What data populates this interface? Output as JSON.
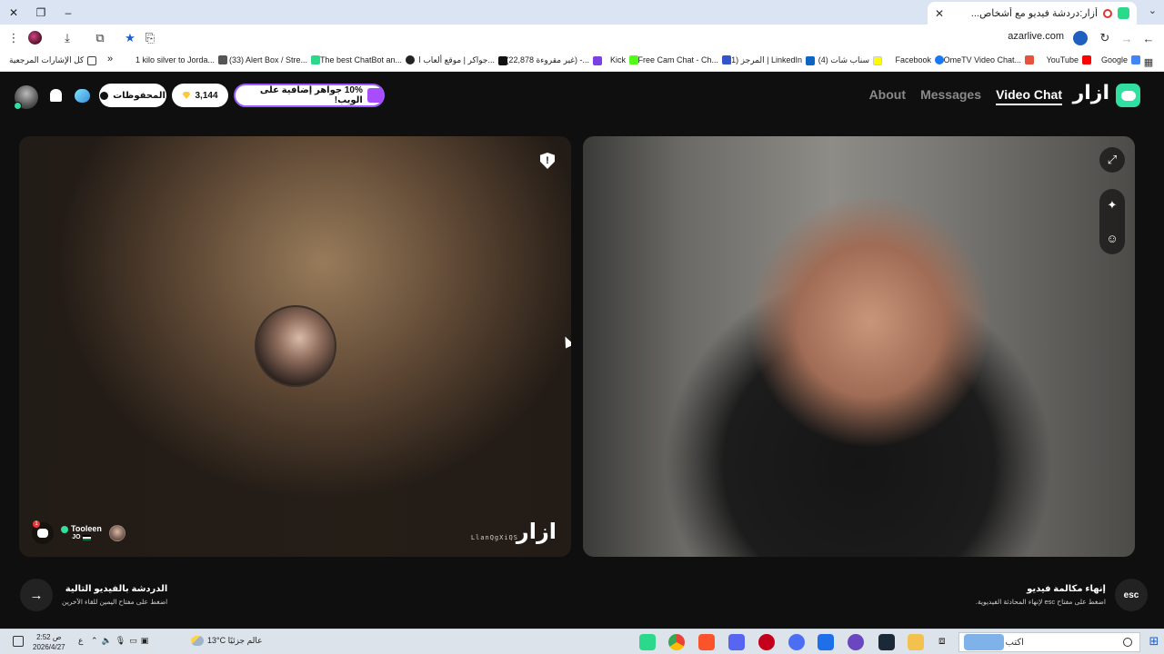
{
  "browser": {
    "tab_title": "أزار:دردشة فيديو مع أشخاص...",
    "url": "azarlive.com",
    "bookmarks": [
      {
        "label": "Google",
        "color": "#4285f4"
      },
      {
        "label": "YouTube",
        "color": "#ff0000"
      },
      {
        "label": "OmeTV Video Chat...",
        "color": "#e5533d"
      },
      {
        "label": "Facebook",
        "color": "#1877f2"
      },
      {
        "label": "(4) سناب شات",
        "color": "#fffc00"
      },
      {
        "label": "(1) المرجز | LinkedIn",
        "color": "#0a66c2"
      },
      {
        "label": "Free Cam Chat - Ch...",
        "color": "#3355cc"
      },
      {
        "label": "Kick",
        "color": "#53fc18"
      },
      {
        "label": "(22,878 غير مقروءة) -...",
        "color": "#7b3fe4"
      },
      {
        "label": "جواكر | موقع ألعاب ا...",
        "color": "#111111"
      },
      {
        "label": "The best ChatBot an...",
        "color": "#222222"
      },
      {
        "label": "(33) Alert Box / Stre...",
        "color": "#2bd98b"
      },
      {
        "label": "1 kilo silver to Jorda...",
        "color": "#555555"
      },
      {
        "label": "كل الإشارات المرجعية",
        "color": "#444444"
      }
    ]
  },
  "header": {
    "brand": "ازار",
    "nav": {
      "video_chat": "Video Chat",
      "messages": "Messages",
      "about": "About"
    },
    "promo": "10% جواهر إضافية على الويب!",
    "gems": "3,144",
    "saved": "المحفوظات"
  },
  "partner": {
    "name": "Tooleen",
    "country": "JO",
    "code": "LlanQgXiQS",
    "watermark": "ازار",
    "unread": "1",
    "report_icon": "!"
  },
  "bottom": {
    "next_title": "الدردشة بالفيديو التالية",
    "next_sub": "اضغط على مفتاح اليمين للقاء الآخرين",
    "end_title": "إنهاء مكالمة فيديو",
    "end_sub": "اضغط على مفتاح esc لإنهاء المحادثة الفيديوية.",
    "esc": "esc"
  },
  "taskbar": {
    "search_placeholder": "اكتب هنا للبحث",
    "weather": "13°C  عالم جزئيًا",
    "lang": "ع",
    "time": "2:52 ص",
    "date": "2026/4/27"
  },
  "colors": {
    "accent": "#2fe0a0",
    "promo_border": "#9b5cff",
    "gem": "#ffc83a"
  }
}
